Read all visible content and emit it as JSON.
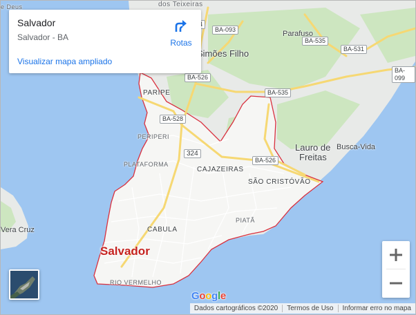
{
  "info_card": {
    "title": "Salvador",
    "subtitle": "Salvador - BA",
    "enlarge_link": "Visualizar mapa ampliado",
    "directions_label": "Rotas"
  },
  "labels": {
    "top_cut_left": "e Deus",
    "top_cut_right": "dos Teixeiras",
    "simoes_filho": "Simões Filho",
    "parafuso": "Parafuso",
    "lauro_1": "Lauro de",
    "lauro_2": "Freitas",
    "busca_vida": "Busca-Vida",
    "vera_cruz": "Vera Cruz",
    "salvador": "Salvador",
    "paripe": "PARIPE",
    "periperi": "PERIPERI",
    "plataforma": "PLATAFORMA",
    "cajazeiras": "CAJAZEIRAS",
    "sao_cristovao": "SÃO CRISTÓVÃO",
    "piata": "PIATÃ",
    "cabula": "CABULA",
    "rio_vermelho": "RIO VERMELHO"
  },
  "road_shields": {
    "ba093": "BA-093",
    "ba535_top": "BA-535",
    "ba531": "BA-531",
    "ba099": "BA-099",
    "ba526_top": "BA-526",
    "ba535_mid": "BA-535",
    "ba528": "BA-528",
    "br324": "324",
    "ba526_mid": "BA-526",
    "cut_top": "4"
  },
  "controls": {
    "zoom_in": "+",
    "zoom_out": "−"
  },
  "logo": {
    "G": "G",
    "o1": "o",
    "o2": "o",
    "g": "g",
    "l": "l",
    "e": "e"
  },
  "attribution": {
    "data": "Dados cartográficos ©2020",
    "terms": "Termos de Uso",
    "report": "Informar erro no mapa"
  },
  "colors": {
    "water": "#9ec6f1",
    "land": "#e8eae8",
    "park": "#cde6c0",
    "city_fill": "#f6f6f4",
    "boundary": "#d9303e",
    "highway": "#f6d873",
    "link": "#1a73e8"
  }
}
